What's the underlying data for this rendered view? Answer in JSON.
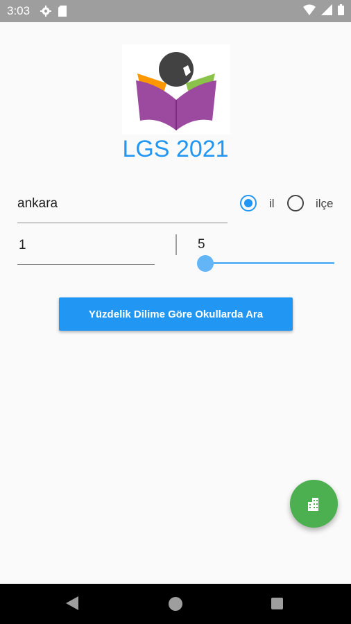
{
  "status_bar": {
    "time": "3:03",
    "left_icons": [
      "gear-icon",
      "sd-card-icon"
    ],
    "right_icons": [
      "wifi-icon",
      "signal-icon",
      "battery-icon"
    ]
  },
  "app": {
    "title": "LGS 2021",
    "logo_icon": "reading-book-logo",
    "accent_color": "#2196f3"
  },
  "form": {
    "city_value": "ankara",
    "radio_il_label": "il",
    "radio_ilce_label": "ilçe",
    "selected_radio": "il",
    "min_value": "1",
    "max_value": "5",
    "search_button_label": "Yüzdelik Dilime Göre Okullarda Ara"
  },
  "fab": {
    "icon": "building-icon",
    "color": "#4caf50"
  },
  "nav_bar": {
    "buttons": [
      "back-icon",
      "home-icon",
      "recent-apps-icon"
    ]
  }
}
